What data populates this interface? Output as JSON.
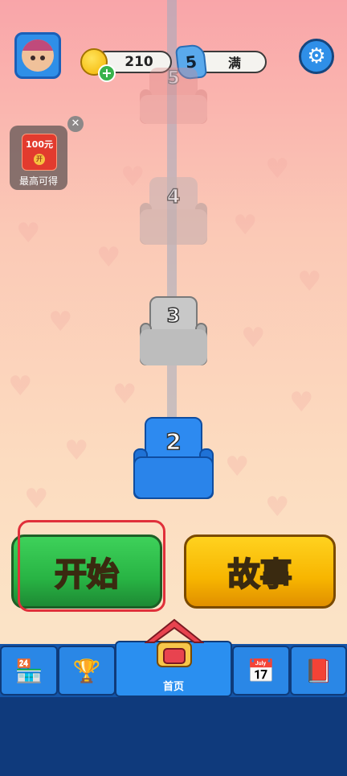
{
  "header": {
    "coins": "210",
    "lives": "5",
    "lives_status": "满"
  },
  "promo": {
    "amount": "100元",
    "open": "开",
    "caption": "最高可得"
  },
  "levels": [
    {
      "number": "5",
      "state": "locked-far"
    },
    {
      "number": "4",
      "state": "locked"
    },
    {
      "number": "3",
      "state": "locked"
    },
    {
      "number": "2",
      "state": "current"
    }
  ],
  "buttons": {
    "start": "开始",
    "story": "故事"
  },
  "nav": {
    "items": [
      {
        "icon": "shop-icon"
      },
      {
        "icon": "trophy-icon"
      },
      {
        "icon": "home-icon",
        "label": "首页"
      },
      {
        "icon": "calendar-icon"
      },
      {
        "icon": "book-icon"
      }
    ]
  },
  "colors": {
    "start_green": "#28b444",
    "story_yellow": "#f7b500",
    "current_level_blue": "#2d8af0",
    "highlight_red": "#e0303a"
  }
}
